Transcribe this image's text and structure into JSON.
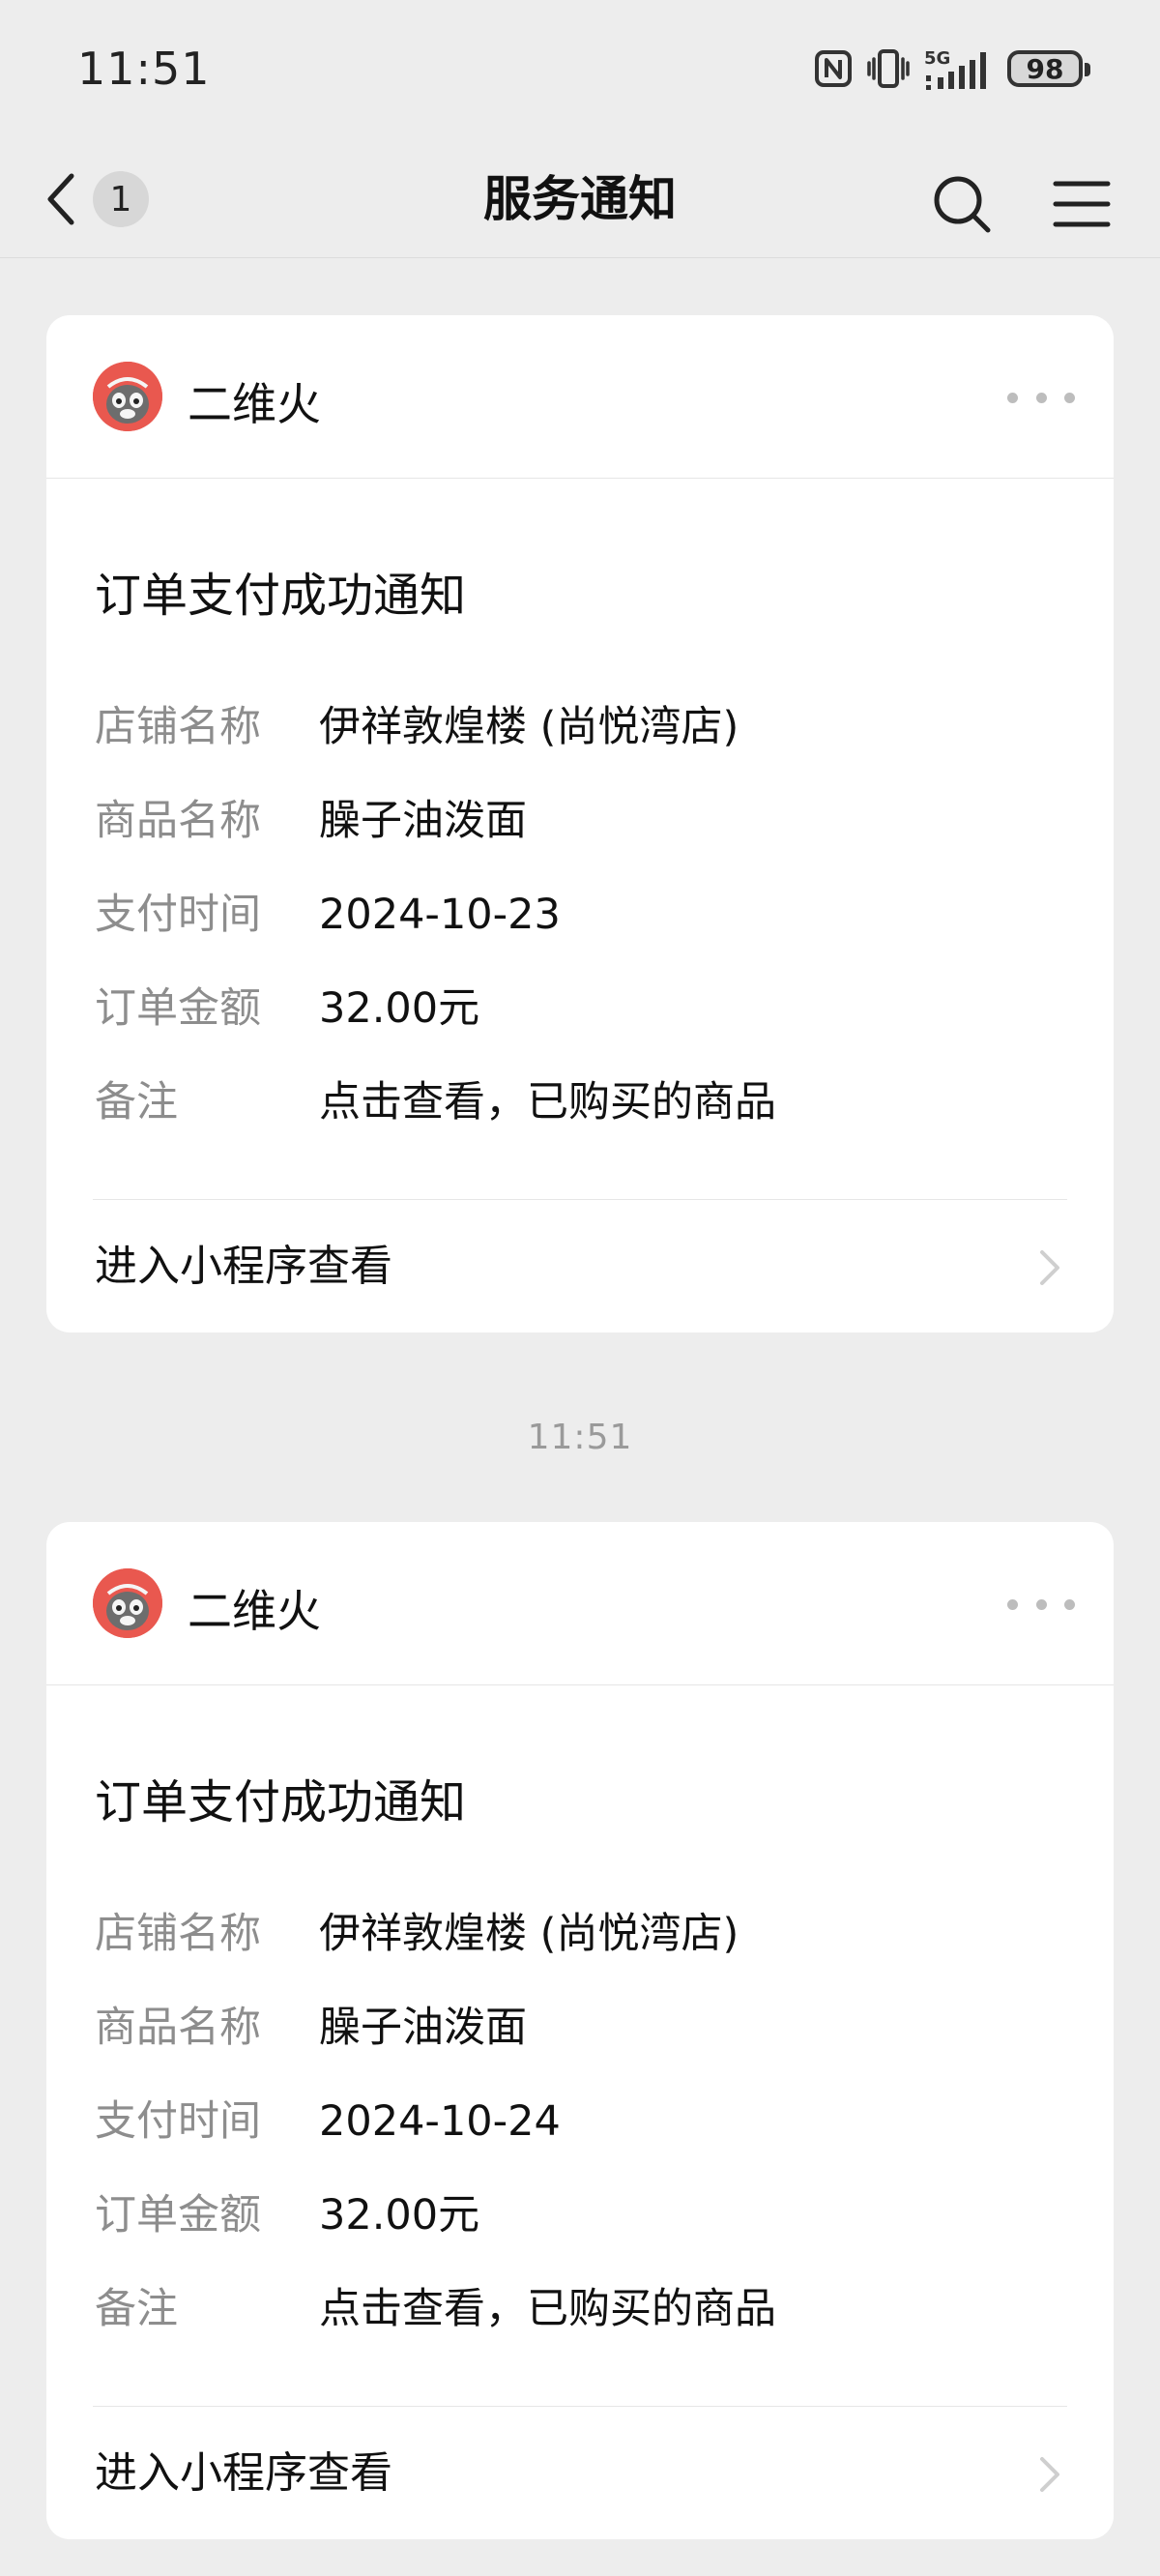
{
  "status_bar": {
    "time": "11:51",
    "battery": "98",
    "network": "5G",
    "icons": [
      "nfc-icon",
      "vibrate-icon",
      "signal-5g-icon",
      "battery-icon"
    ]
  },
  "nav": {
    "title": "服务通知",
    "unread_count": "1",
    "icons": [
      "back-chevron-icon",
      "search-icon",
      "menu-icon"
    ]
  },
  "messages": [
    {
      "sender": "二维火",
      "title": "订单支付成功通知",
      "fields": [
        {
          "label": "店铺名称",
          "value": "伊祥敦煌楼 (尚悦湾店)"
        },
        {
          "label": "商品名称",
          "value": "臊子油泼面"
        },
        {
          "label": "支付时间",
          "value": "2024-10-23"
        },
        {
          "label": "订单金额",
          "value": "32.00元"
        },
        {
          "label": "备注",
          "value": "点击查看，已购买的商品"
        }
      ],
      "action": "进入小程序查看"
    },
    {
      "sender": "二维火",
      "title": "订单支付成功通知",
      "fields": [
        {
          "label": "店铺名称",
          "value": "伊祥敦煌楼 (尚悦湾店)"
        },
        {
          "label": "商品名称",
          "value": "臊子油泼面"
        },
        {
          "label": "支付时间",
          "value": "2024-10-24"
        },
        {
          "label": "订单金额",
          "value": "32.00元"
        },
        {
          "label": "备注",
          "value": "点击查看，已购买的商品"
        }
      ],
      "action": "进入小程序查看"
    }
  ],
  "divider_time": "11:51",
  "colors": {
    "background": "#ededed",
    "card": "#ffffff",
    "label_gray": "#8d8d8d",
    "avatar_red": "#e9584f"
  }
}
